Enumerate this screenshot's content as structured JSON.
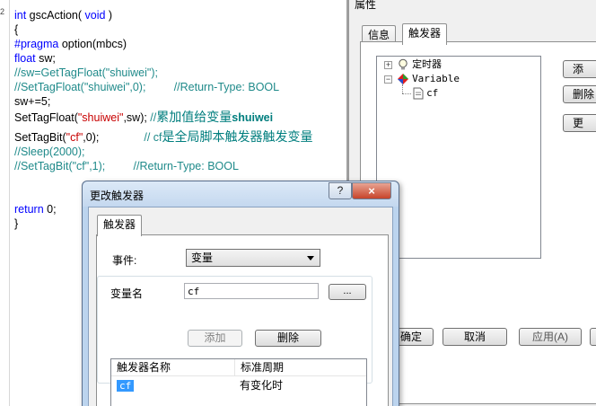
{
  "editor": {
    "gutter_mark": "2",
    "lines": {
      "l1_kw1": "int",
      "l1_name": " gscAction( ",
      "l1_kw2": "void",
      "l1_end": " )",
      "l2": "{",
      "l3_kw": "#pragma",
      "l3_rest": " option(mbcs)",
      "l4_kw": "float",
      "l4_rest": " sw;",
      "l5": "//sw=GetTagFloat(\"shuiwei\");",
      "l6": "//SetTagFloat(\"shuiwei\",0);         //Return-Type: BOOL",
      "l7": "sw+=5;",
      "l8_a": "SetTagFloat(",
      "l8_str": "\"shuiwei\"",
      "l8_b": ",sw); ",
      "l8_cmt": "//",
      "l8_cjk": "累加值给变量",
      "l8_bold": "shuiwei",
      "l9_a": "SetTagBit(",
      "l9_str": "\"cf\"",
      "l9_b": ",0);",
      "l9_cmt": "// cf",
      "l9_cjk": "是全局脚本触发器触发变量",
      "l10": "//Sleep(2000);",
      "l11": "//SetTagBit(\"cf\",1);         //Return-Type: BOOL",
      "l12_kw": "return",
      "l12_rest": " 0;",
      "l13": "}"
    }
  },
  "props": {
    "title": "属性",
    "tabs": {
      "info": "信息",
      "trigger": "触发器"
    },
    "tree": {
      "timer": "定时器",
      "variable": "Variable",
      "cf": "cf"
    },
    "side_buttons": {
      "add": "添",
      "delete": "删除",
      "more": "更"
    },
    "bottom_buttons": {
      "ok": "确定",
      "cancel": "取消",
      "apply": "应用(A)"
    }
  },
  "dialog": {
    "title": "更改触发器",
    "help": "?",
    "close": "×",
    "tab": "触发器",
    "event_label": "事件:",
    "event_value": "变量",
    "var_label": "变量名",
    "var_value": "cf",
    "browse": "...",
    "add": "添加",
    "delete": "删除",
    "list": {
      "headers": [
        "触发器名称",
        "标准周期"
      ],
      "rows": [
        {
          "name": "cf",
          "period": "有变化时"
        }
      ]
    }
  }
}
